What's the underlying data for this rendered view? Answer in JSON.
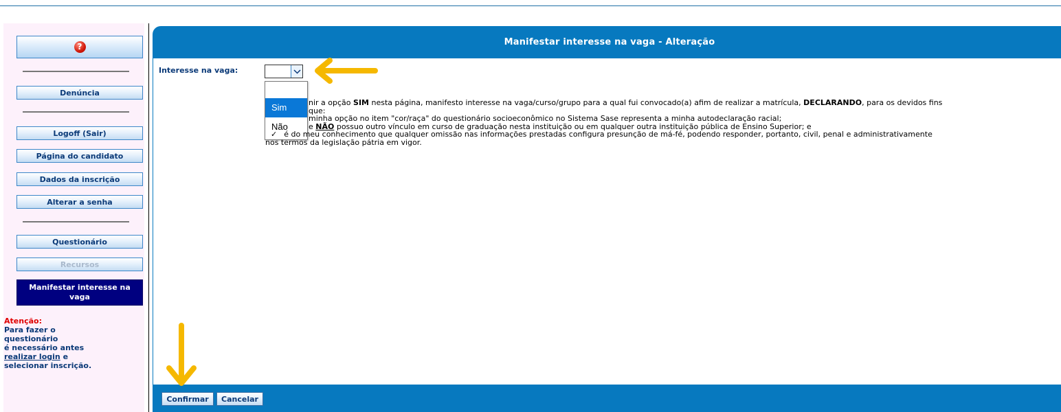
{
  "sidebar": {
    "help_icon_glyph": "?",
    "buttons": {
      "denuncia": "Denúncia",
      "logoff": "Logoff (Sair)",
      "pagina_candidato": "Página do candidato",
      "dados_inscricao": "Dados da inscrição",
      "alterar_senha": "Alterar a senha",
      "questionario": "Questionário",
      "recursos": "Recursos",
      "manifestar": "Manifestar interesse na vaga"
    },
    "attention": {
      "title": "Atenção:",
      "line1": "Para fazer o",
      "line2": "questionário",
      "line3": "é necessário antes",
      "link": "realizar login",
      "line4_tail": " e",
      "line5": "selecionar inscrição."
    }
  },
  "panel": {
    "title": "Manifestar interesse na vaga - Alteração",
    "interesse_label": "Interesse na vaga:",
    "select": {
      "value": "",
      "options": [
        "",
        "Sim",
        "Não"
      ],
      "highlighted": "Sim"
    },
    "declaration": {
      "l1_a": "nir a opção ",
      "l1_b": "SIM",
      "l1_c": " nesta página, manifesto interesse na vaga/curso/grupo para a qual fui convocado(a) afim de realizar a matrícula, ",
      "l1_d": "DECLARANDO",
      "l1_e": ", para os devidos fins",
      "l2": "que:",
      "l3": "minha opção no item \"cor/raça\" do questionário socioeconômico no Sistema Sase representa a minha autodeclaração racial;",
      "l4_a": "e ",
      "l4_b": "NÃO",
      "l4_c": " possuo outro vínculo em curso de graduação nesta instituição ou em qualquer outra instituição pública de Ensino Superior; e",
      "l5_check": "✓",
      "l5": "é do meu conhecimento que qualquer omissão nas informações prestadas configura presunção de má-fé, podendo responder, portanto, civil, penal e administrativamente",
      "l6": "nos termos da legislação pátria em vigor."
    },
    "footer": {
      "confirm": "Confirmar",
      "cancel": "Cancelar"
    }
  },
  "colors": {
    "primary_blue": "#0779bf",
    "nav_text": "#0b3a78",
    "active_nav": "#000080",
    "attention_red": "#e00000",
    "annotation_arrow": "#f5b800",
    "sidebar_bg": "#fdf1fb"
  }
}
